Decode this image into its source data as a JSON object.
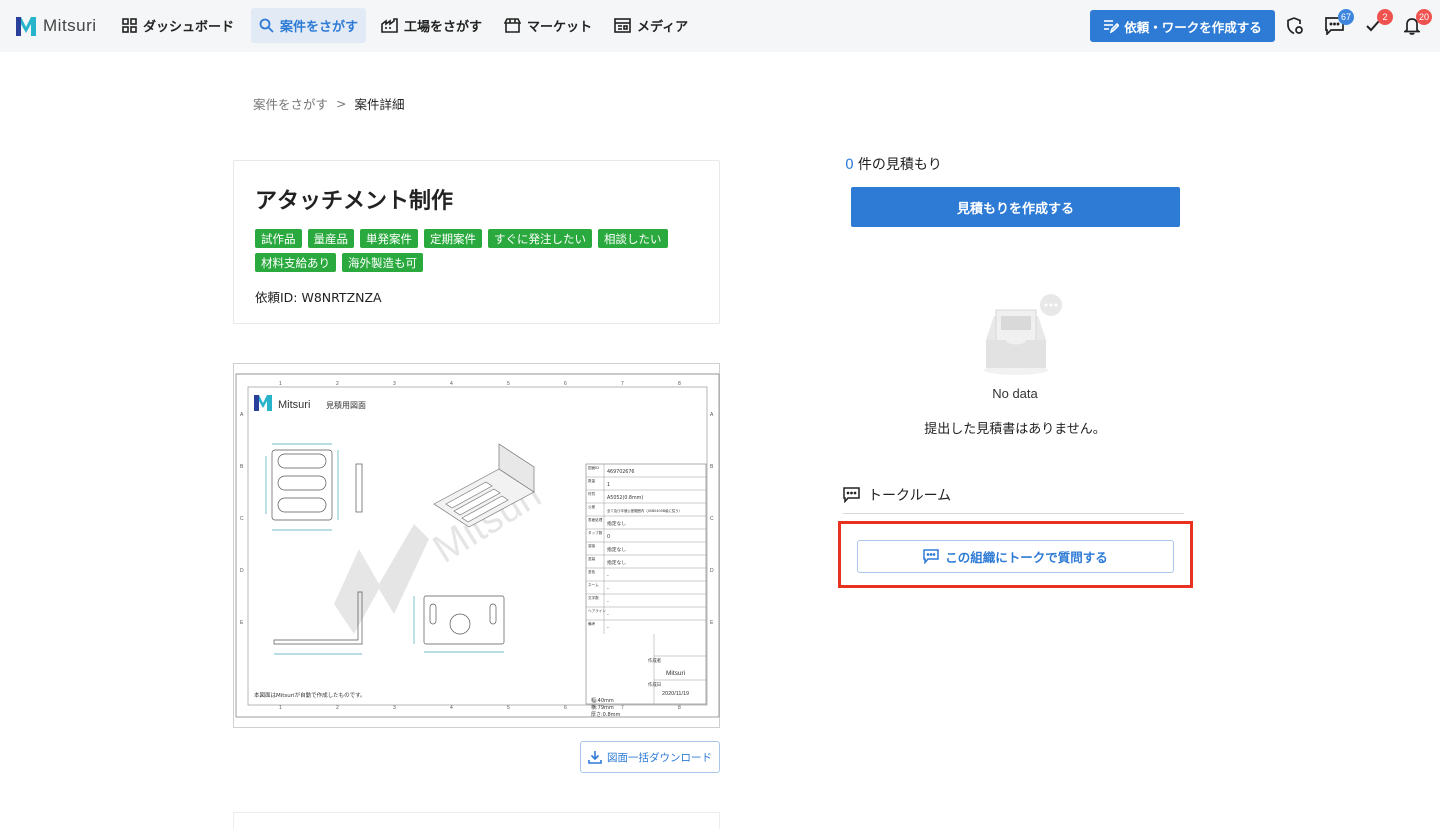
{
  "app": {
    "name": "Mitsuri"
  },
  "nav": {
    "items": [
      {
        "label": "ダッシュボード",
        "icon": "grid-icon"
      },
      {
        "label": "案件をさがす",
        "icon": "search-icon",
        "active": true
      },
      {
        "label": "工場をさがす",
        "icon": "factory-icon"
      },
      {
        "label": "マーケット",
        "icon": "store-icon"
      },
      {
        "label": "メディア",
        "icon": "newspaper-icon"
      }
    ],
    "create_label": "依頼・ワークを作成する",
    "badges": {
      "messages": "67",
      "tasks": "2",
      "notifications": "20"
    }
  },
  "breadcrumb": {
    "parent": "案件をさがす",
    "separator": ">",
    "current": "案件詳細"
  },
  "project": {
    "title": "アタッチメント制作",
    "tags": [
      "試作品",
      "量産品",
      "単発案件",
      "定期案件",
      "すぐに発注したい",
      "相談したい",
      "材料支給あり",
      "海外製造も可"
    ],
    "request_id": "依頼ID: W8NRTZNZA"
  },
  "drawing": {
    "header_text": "見積用図面",
    "logo_text": "Mitsuri",
    "footer_note": "本図面はMitsuriが自動で作成したものです。",
    "col_numbers": [
      "1",
      "2",
      "3",
      "4",
      "5",
      "6",
      "7",
      "8"
    ],
    "row_letters": [
      "A",
      "B",
      "C",
      "D",
      "E"
    ],
    "table_rows": [
      {
        "label": "図面ID",
        "value": "469702676"
      },
      {
        "label": "数量",
        "value": "1"
      },
      {
        "label": "材質",
        "value": "A5052(0.8mm)"
      },
      {
        "label": "公差",
        "value": "全て及び半値公差範囲内（JISB0405B級に従う）"
      },
      {
        "label": "表面処理",
        "value": "指定なし"
      },
      {
        "label": "タップ数",
        "value": "0"
      },
      {
        "label": "溶接",
        "value": "指定なし"
      },
      {
        "label": "塗装",
        "value": "指定なし"
      },
      {
        "label": "塗色",
        "value": "-"
      },
      {
        "label": "ネーム",
        "value": "-"
      },
      {
        "label": "文字数",
        "value": "-"
      },
      {
        "label": "ヘアライン",
        "value": "-"
      },
      {
        "label": "備考",
        "value": "-"
      }
    ],
    "author_label": "作成者",
    "date_label": "作成日",
    "date": "2020/11/19",
    "dims": [
      "幅:40mm",
      "横:79mm",
      "厚さ:0.8mm"
    ]
  },
  "download_label": "図面一括ダウンロード",
  "quotes": {
    "count": "0",
    "suffix": "件の見積もり",
    "create_label": "見積もりを作成する"
  },
  "empty": {
    "title": "No data",
    "message": "提出した見積書はありません。"
  },
  "talk": {
    "title": "トークルーム",
    "button_label": "この組織にトークで質問する"
  },
  "colors": {
    "primary": "#2e7bd6",
    "tag_green": "#2aaa3e",
    "highlight": "#e8321f",
    "badge_red": "#ef5350"
  }
}
